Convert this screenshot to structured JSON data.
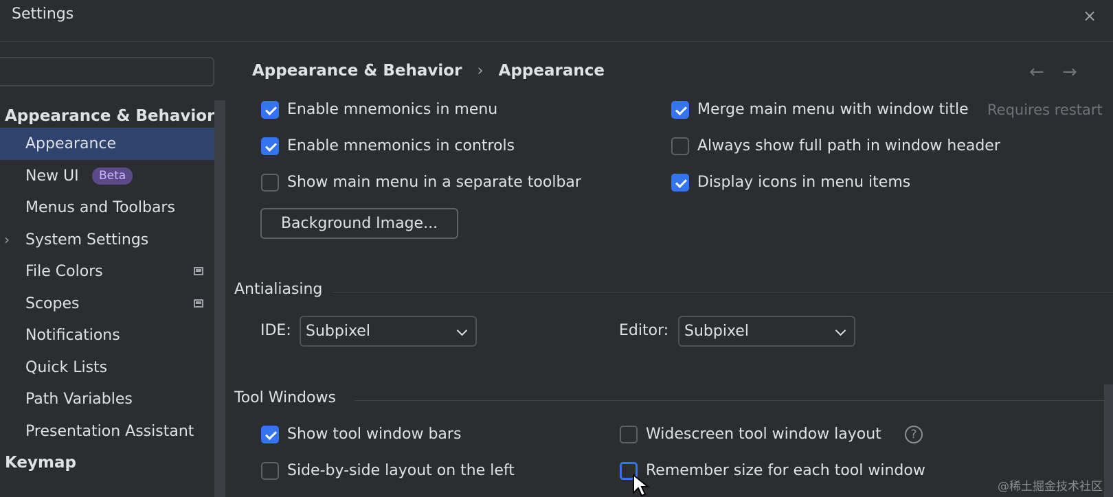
{
  "window": {
    "title": "Settings",
    "close_glyph": "×"
  },
  "breadcrumb": {
    "parent": "Appearance & Behavior",
    "separator": "›",
    "current": "Appearance"
  },
  "nav": {
    "back": "←",
    "forward": "→"
  },
  "sidebar": {
    "items": [
      {
        "label": "Appearance & Behavior",
        "group": true
      },
      {
        "label": "Appearance",
        "selected": true
      },
      {
        "label": "New UI",
        "badge": "Beta"
      },
      {
        "label": "Menus and Toolbars"
      },
      {
        "label": "System Settings",
        "expandable": true
      },
      {
        "label": "File Colors",
        "project_icon": true
      },
      {
        "label": "Scopes",
        "project_icon": true
      },
      {
        "label": "Notifications"
      },
      {
        "label": "Quick Lists"
      },
      {
        "label": "Path Variables"
      },
      {
        "label": "Presentation Assistant"
      },
      {
        "label": "Keymap",
        "group": true
      }
    ]
  },
  "options": {
    "enable_mnemonics_menu": {
      "label": "Enable mnemonics in menu",
      "checked": true
    },
    "enable_mnemonics_controls": {
      "label": "Enable mnemonics in controls",
      "checked": true
    },
    "main_menu_separate_toolbar": {
      "label": "Show main menu in a separate toolbar",
      "checked": false
    },
    "merge_main_menu": {
      "label": "Merge main menu with window title",
      "checked": true,
      "hint": "Requires restart"
    },
    "full_path_header": {
      "label": "Always show full path in window header",
      "checked": false
    },
    "display_icons_menu": {
      "label": "Display icons in menu items",
      "checked": true
    },
    "background_image_button": "Background Image..."
  },
  "antialiasing": {
    "title": "Antialiasing",
    "ide_label": "IDE:",
    "ide_value": "Subpixel",
    "editor_label": "Editor:",
    "editor_value": "Subpixel"
  },
  "tool_windows": {
    "title": "Tool Windows",
    "show_bars": {
      "label": "Show tool window bars",
      "checked": true
    },
    "side_by_side": {
      "label": "Side-by-side layout on the left",
      "checked": false
    },
    "widescreen": {
      "label": "Widescreen tool window layout",
      "checked": false
    },
    "remember_size": {
      "label": "Remember size for each tool window",
      "checked": false
    },
    "help_glyph": "?"
  },
  "watermark": "@稀土掘金技术社区",
  "colors": {
    "accent": "#3574f0",
    "selection": "#2e436e",
    "background": "#2b2d30",
    "beta_badge": "#5a4a88"
  }
}
